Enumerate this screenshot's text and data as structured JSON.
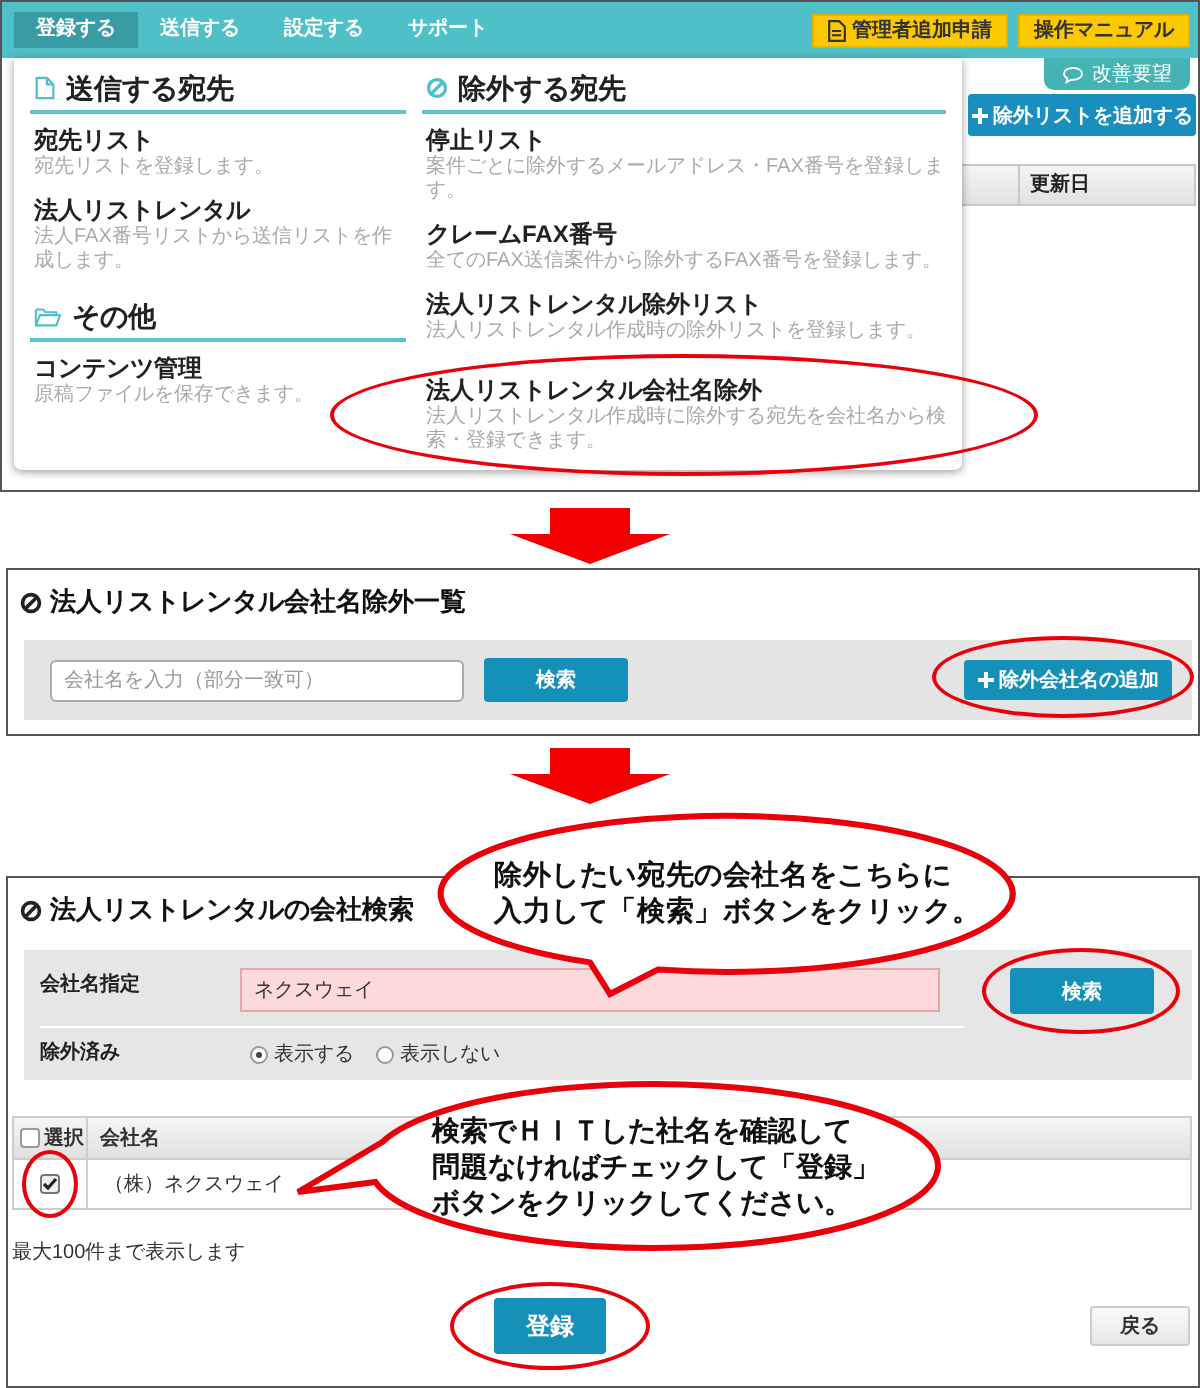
{
  "top_screen": {
    "menu": [
      {
        "label": "登録する",
        "selected": true
      },
      {
        "label": "送信する",
        "selected": false
      },
      {
        "label": "設定する",
        "selected": false
      },
      {
        "label": "サポート",
        "selected": false
      }
    ],
    "header_buttons": [
      {
        "kind": "document",
        "label": "管理者追加申請"
      },
      {
        "kind": "plain",
        "label": "操作マニュアル"
      }
    ],
    "feedback_tab": "改善要望",
    "add_list_button": "除外リストを追加する",
    "table_columns": [
      "更新日"
    ],
    "dropdown": {
      "columns": [
        {
          "sections": [
            {
              "kind": "document",
              "heading": "送信する宛先",
              "items": [
                {
                  "title": "宛先リスト",
                  "description": "宛先リストを登録します。",
                  "circled": false
                },
                {
                  "title": "法人リストレンタル",
                  "description": "法人FAX番号リストから送信リストを作成します。",
                  "circled": false
                }
              ]
            },
            {
              "kind": "folder",
              "heading": "その他",
              "items": [
                {
                  "title": "コンテンツ管理",
                  "description": "原稿ファイルを保存できます。",
                  "circled": false
                }
              ]
            }
          ]
        },
        {
          "sections": [
            {
              "kind": "prohibited",
              "heading": "除外する宛先",
              "items": [
                {
                  "title": "停止リスト",
                  "description": "案件ごとに除外するメールアドレス・FAX番号を登録します。",
                  "circled": false
                },
                {
                  "title": "クレームFAX番号",
                  "description": "全てのFAX送信案件から除外するFAX番号を登録します。",
                  "circled": false
                },
                {
                  "title": "法人リストレンタル除外リスト",
                  "description": "法人リストレンタル作成時の除外リストを登録します。",
                  "circled": false
                },
                {
                  "title": "法人リストレンタル会社名除外",
                  "description": "法人リストレンタル作成時に除外する宛先を会社名から検索・登録できます。",
                  "circled": true
                }
              ]
            }
          ]
        }
      ]
    }
  },
  "list_screen": {
    "title": "法人リストレンタル会社名除外一覧",
    "search_field": {
      "placeholder": "会社名を入力（部分一致可）"
    },
    "search_button": {
      "label": "検索"
    },
    "add_button": {
      "label": "除外会社名の追加",
      "circled": true
    }
  },
  "search_screen": {
    "title": "法人リストレンタルの会社検索",
    "company_field": {
      "label": "会社名指定",
      "value": "ネクスウェイ"
    },
    "search_button": {
      "label": "検索",
      "circled": true
    },
    "excluded_filter": {
      "label": "除外済み",
      "options": [
        {
          "label": "表示する",
          "selected": true
        },
        {
          "label": "表示しない",
          "selected": false
        }
      ]
    },
    "results_table": {
      "select_all": {
        "label": "選択",
        "checked": false
      },
      "columns": [
        "会社名"
      ],
      "rows": [
        {
          "checked": true,
          "circled": true,
          "company": "（株）ネクスウェイ"
        }
      ]
    },
    "note": "最大100件まで表示します",
    "register_button": {
      "label": "登録",
      "circled": true
    },
    "back_button": {
      "label": "戻る"
    },
    "callouts": [
      {
        "kind": "downward",
        "lines": [
          "除外したい宛先の会社名をこちらに",
          "入力して「検索」ボタンをクリック。"
        ]
      },
      {
        "kind": "leftward",
        "lines": [
          "検索でＨＩＴした社名を確認して",
          "問題なければチェックして「登録」",
          "ボタンをクリックしてください。"
        ]
      }
    ]
  }
}
